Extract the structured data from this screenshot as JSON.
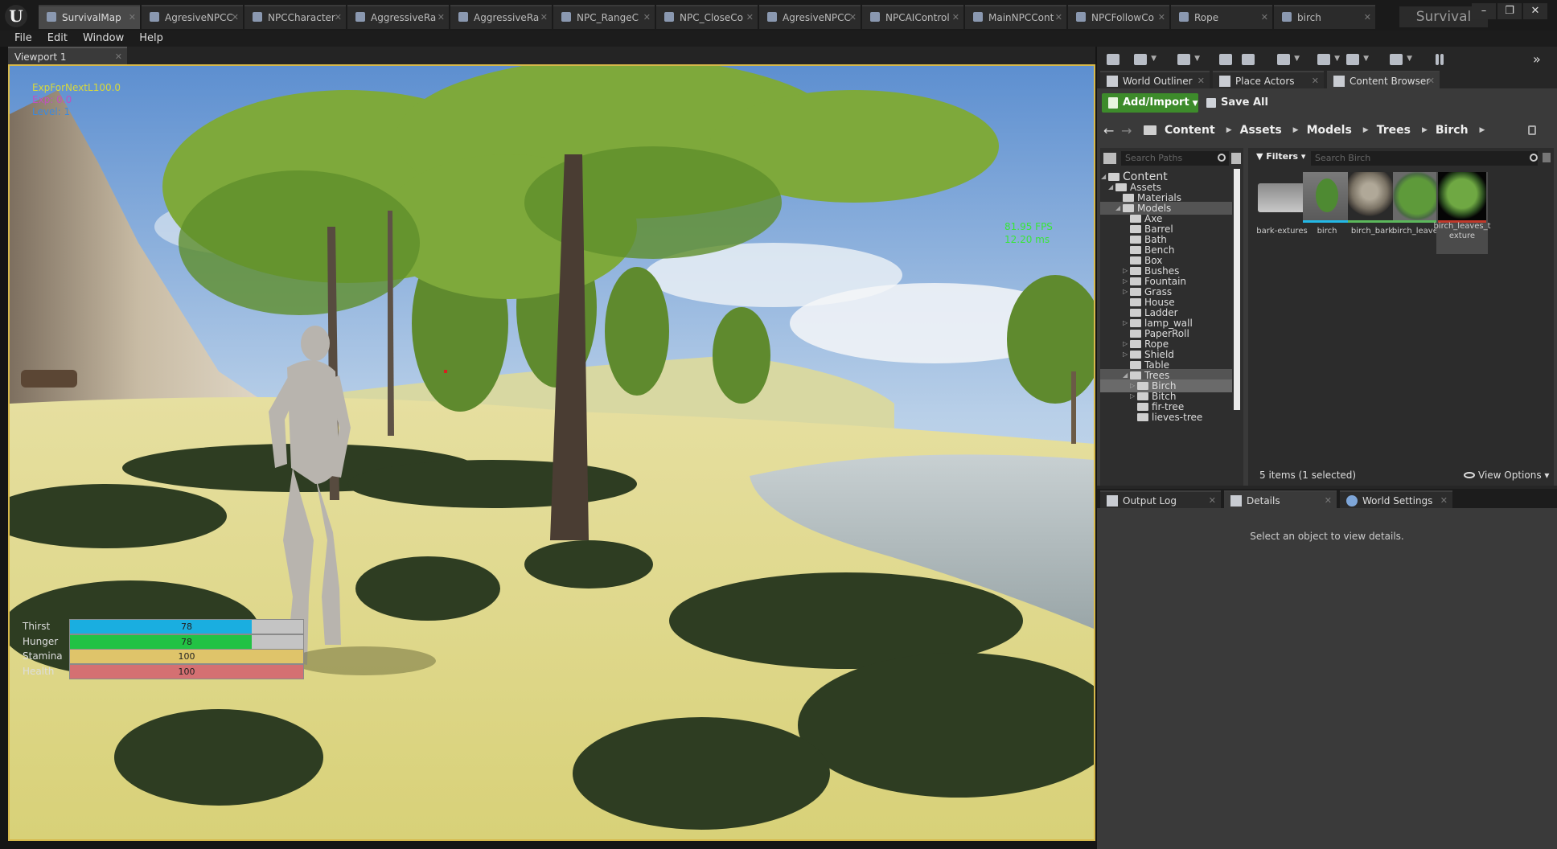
{
  "app": {
    "name": "Survival",
    "window_buttons": [
      "–",
      "❐",
      "✕"
    ]
  },
  "tabs": [
    {
      "label": "SurvivalMap",
      "icon": "map-icon",
      "active": true
    },
    {
      "label": "AgresiveNPCC",
      "icon": "blueprint-icon"
    },
    {
      "label": "NPCCharacter",
      "icon": "blueprint-icon"
    },
    {
      "label": "AggressiveRa",
      "icon": "blueprint-icon"
    },
    {
      "label": "AggressiveRa",
      "icon": "blueprint-icon"
    },
    {
      "label": "NPC_RangeC",
      "icon": "behavior-icon"
    },
    {
      "label": "NPC_CloseCo",
      "icon": "behavior-icon"
    },
    {
      "label": "AgresiveNPCC",
      "icon": "blueprint-icon"
    },
    {
      "label": "NPCAIControl",
      "icon": "blueprint-icon"
    },
    {
      "label": "MainNPCCont",
      "icon": "behavior-icon"
    },
    {
      "label": "NPCFollowCo",
      "icon": "behavior-icon"
    },
    {
      "label": "Rope",
      "icon": "sphere-icon"
    },
    {
      "label": "birch",
      "icon": "mesh-icon"
    }
  ],
  "menu": [
    "File",
    "Edit",
    "Window",
    "Help"
  ],
  "viewport": {
    "tab_label": "Viewport 1",
    "hud": {
      "exp_next": "ExpForNextL100.0",
      "exp": "Exp: 0.0",
      "level": "Level: 1"
    },
    "fps": "81.95 FPS",
    "ms": "12.20 ms",
    "stats": [
      {
        "label": "Thirst",
        "value": "78",
        "fraction": 0.78,
        "color": "#1aaee0",
        "empty": "#c4c4c4"
      },
      {
        "label": "Hunger",
        "value": "78",
        "fraction": 0.78,
        "color": "#22c244",
        "empty": "#c4c4c4"
      },
      {
        "label": "Stamina",
        "value": "100",
        "fraction": 1.0,
        "color": "#dfc46a",
        "empty": "#c4c4c4"
      },
      {
        "label": "Health",
        "value": "100",
        "fraction": 1.0,
        "color": "#d47072",
        "empty": "#c4c4c4"
      }
    ]
  },
  "panel_tabs": [
    {
      "label": "World Outliner",
      "icon": "outliner-icon"
    },
    {
      "label": "Place Actors",
      "icon": "place-icon"
    },
    {
      "label": "Content Browser",
      "icon": "content-icon",
      "active": true
    }
  ],
  "content_browser": {
    "add_import": "Add/Import",
    "save_all": "Save All",
    "breadcrumbs": [
      "Content",
      "Assets",
      "Models",
      "Trees",
      "Birch"
    ],
    "search_paths_placeholder": "Search Paths",
    "filters_label": "Filters",
    "search_placeholder": "Search Birch",
    "tree": [
      {
        "label": "Content",
        "expanded": true
      },
      {
        "label": "Assets",
        "expanded": true
      },
      {
        "label": "Materials"
      },
      {
        "label": "Models",
        "expanded": true,
        "highlight": true
      },
      {
        "label": "Axe"
      },
      {
        "label": "Barrel"
      },
      {
        "label": "Bath"
      },
      {
        "label": "Bench"
      },
      {
        "label": "Box"
      },
      {
        "label": "Bushes"
      },
      {
        "label": "Fountain"
      },
      {
        "label": "Grass"
      },
      {
        "label": "House"
      },
      {
        "label": "Ladder"
      },
      {
        "label": "lamp_wall"
      },
      {
        "label": "PaperRoll"
      },
      {
        "label": "Rope"
      },
      {
        "label": "Shield"
      },
      {
        "label": "Table"
      },
      {
        "label": "Trees",
        "expanded": true,
        "highlight": true
      },
      {
        "label": "Birch",
        "selected": true
      },
      {
        "label": "Bitch"
      },
      {
        "label": "fir-tree"
      },
      {
        "label": "lieves-tree"
      }
    ],
    "assets": [
      {
        "name": "bark-extures",
        "type": "folder",
        "bar_color": ""
      },
      {
        "name": "birch",
        "type": "static-mesh",
        "bar_color": "#23b8e6"
      },
      {
        "name": "birch_bark",
        "type": "material",
        "bar_color": "#5cb85c"
      },
      {
        "name": "birch_leaves",
        "type": "material",
        "bar_color": "#5cb85c"
      },
      {
        "name": "birch_leaves_texture",
        "type": "texture",
        "bar_color": "#c0392b",
        "selected": true
      }
    ],
    "item_count": "5 items (1 selected)",
    "view_options": "View Options"
  },
  "lower_tabs": [
    {
      "label": "Output Log",
      "icon": "log-icon"
    },
    {
      "label": "Details",
      "icon": "details-icon",
      "active": true
    },
    {
      "label": "World Settings",
      "icon": "globe-icon"
    }
  ],
  "details_message": "Select an object to view details.",
  "colors": {
    "viewport_border": "#d6b84a",
    "add_import_bg": "#3d8b2b",
    "fps_green": "#39e639"
  }
}
